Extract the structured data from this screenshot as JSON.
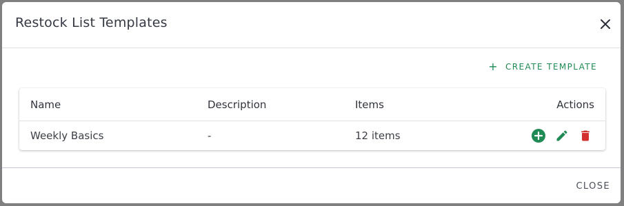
{
  "dialog": {
    "title": "Restock List Templates",
    "close_icon": "close-icon",
    "create_label": "CREATE TEMPLATE",
    "create_icon": "plus-icon",
    "close_label": "CLOSE"
  },
  "table": {
    "columns": [
      "Name",
      "Description",
      "Items",
      "Actions"
    ],
    "rows": [
      {
        "name": "Weekly Basics",
        "description": "-",
        "items": "12 items",
        "actions": [
          "add-circle-icon",
          "edit-pencil-icon",
          "trash-icon"
        ]
      }
    ]
  },
  "colors": {
    "accent_green": "#1f8a54",
    "danger_red": "#d32f2f",
    "backdrop": "#808080"
  }
}
